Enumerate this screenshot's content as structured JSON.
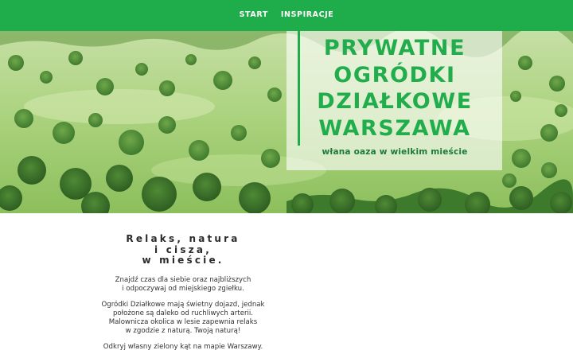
{
  "nav": {
    "items": [
      {
        "label": "START"
      },
      {
        "label": "INSPIRACJE"
      }
    ]
  },
  "hero": {
    "title_lines": [
      "PRYWATNE",
      "OGRÓDKI",
      "DZIAŁKOWE",
      "WARSZAWA"
    ],
    "subtitle": "włana oaza w wielkim mieście",
    "image": "aerial-green-meadow-forest"
  },
  "content": {
    "headline_lines": [
      "Relaks, natura",
      "i cisza,",
      "w mieście."
    ],
    "paragraphs": [
      [
        "Znajdź czas dla siebie oraz najbliższych",
        "i odpoczywaj od miejskiego zgiełku."
      ],
      [
        "Ogródki Działkowe mają świetny dojazd, jednak",
        "położone są daleko od ruchliwych arterii.",
        "Malownicza okolica w lesie zapewnia relaks",
        "w zgodzie z naturą. Twoją naturą!"
      ],
      [
        "Odkryj własny zielony kąt na mapie Warszawy."
      ]
    ]
  },
  "colors": {
    "accent": "#1fac4a",
    "title_green": "#22ad4c",
    "subtitle_green": "#1e7a3a"
  }
}
